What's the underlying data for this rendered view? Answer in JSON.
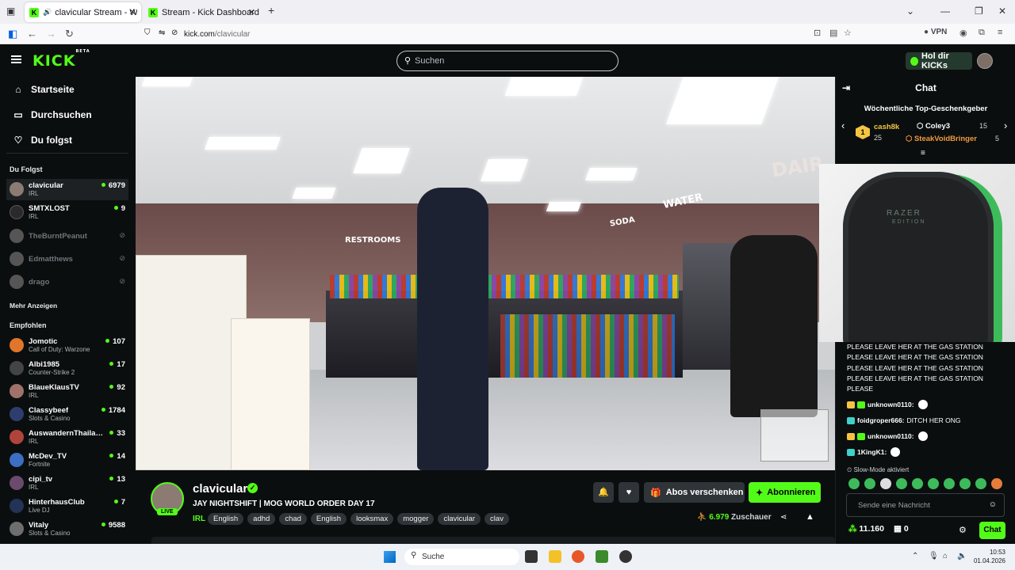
{
  "browser": {
    "tabs": [
      {
        "title": "clavicular Stream - Watch L",
        "active": true
      },
      {
        "title": "Stream - Kick Dashboard",
        "active": false
      }
    ],
    "new_tab": "+",
    "url_host": "kick.com",
    "url_path": "/clavicular",
    "vpn_label": "VPN"
  },
  "header": {
    "logo": "KICK",
    "logo_badge": "BETA",
    "search_placeholder": "Suchen",
    "get_kicks": "Hol dir KICKs"
  },
  "sidebar": {
    "nav": [
      {
        "label": "Startseite",
        "icon": "home-icon"
      },
      {
        "label": "Durchsuchen",
        "icon": "browse-icon"
      },
      {
        "label": "Du folgst",
        "icon": "heart-icon"
      }
    ],
    "following_title": "Du Folgst",
    "following": [
      {
        "name": "clavicular",
        "category": "IRL",
        "viewers": "6979",
        "live": true,
        "color": "#8b7b73"
      },
      {
        "name": "SMTXLOST",
        "category": "IRL",
        "viewers": "9",
        "live": true,
        "color": "#2a2a2a"
      },
      {
        "name": "TheBurntPeanut",
        "live": false,
        "color": "#555"
      },
      {
        "name": "Edmatthews",
        "live": false,
        "color": "#555"
      },
      {
        "name": "drago",
        "live": false,
        "color": "#555"
      }
    ],
    "show_more": "Mehr Anzeigen",
    "recommended_title": "Empfohlen",
    "recommended": [
      {
        "name": "Jomotic",
        "category": "Call of Duty: Warzone",
        "viewers": "107",
        "color": "#e0762a"
      },
      {
        "name": "Albi1985",
        "category": "Counter-Strike 2",
        "viewers": "17",
        "color": "#444"
      },
      {
        "name": "BlaueKlausTV",
        "category": "IRL",
        "viewers": "92",
        "color": "#a0726a"
      },
      {
        "name": "Classybeef",
        "category": "Slots & Casino",
        "viewers": "1784",
        "color": "#2d3e6e"
      },
      {
        "name": "AuswandernThaila…",
        "category": "IRL",
        "viewers": "33",
        "color": "#b0443a"
      },
      {
        "name": "McDev_TV",
        "category": "Fortnite",
        "viewers": "14",
        "color": "#3c6fc4"
      },
      {
        "name": "cipi_tv",
        "category": "IRL",
        "viewers": "13",
        "color": "#6b4a6e"
      },
      {
        "name": "HinterhausClub",
        "category": "Live DJ",
        "viewers": "7",
        "color": "#223355"
      },
      {
        "name": "Vitaly",
        "category": "Slots & Casino",
        "viewers": "9588",
        "color": "#6e6e6e"
      }
    ]
  },
  "video": {
    "signs": [
      "RESTROOMS",
      "WATER",
      "SODA",
      "DAIR"
    ]
  },
  "stream": {
    "streamer": "clavicular",
    "live_label": "LIVE",
    "title": "JAY NIGHTSHIFT | MOG WORLD ORDER DAY 17",
    "category": "IRL",
    "tags": [
      "English",
      "adhd",
      "chad",
      "English",
      "looksmax",
      "mogger",
      "clavicular",
      "clav"
    ],
    "gift_subs": "Abos verschenken",
    "subscribe": "Abonnieren",
    "viewers": "6.979",
    "viewers_label": "Zuschauer"
  },
  "chat": {
    "title": "Chat",
    "top_gifters_title": "Wöchentliche Top-Geschenkgeber",
    "gifters": [
      {
        "rank": "1",
        "name": "cash8k",
        "count": "25"
      },
      {
        "name": "Coley3",
        "count": "15"
      },
      {
        "name": "SteakVoidBringer",
        "count": "5"
      }
    ],
    "webcam_brand": "RAZER",
    "webcam_sub": "EDITION",
    "spam_lines": [
      "PLEASE LEAVE HER AT THE GAS STATION",
      "PLEASE LEAVE HER AT THE GAS STATION",
      "PLEASE LEAVE HER AT THE GAS STATION",
      "PLEASE LEAVE HER AT THE GAS STATION",
      "PLEASE"
    ],
    "messages": [
      {
        "user": "unknown0110:",
        "text": "",
        "user_color": "#fff"
      },
      {
        "user": "foidgroper666:",
        "text": "DITCH HER ONG",
        "user_color": "#fff"
      },
      {
        "user": "unknown0110:",
        "text": "",
        "user_color": "#fff"
      },
      {
        "user": "1KingK1:",
        "text": "",
        "user_color": "#fff"
      }
    ],
    "slow_mode": "Slow-Mode aktiviert",
    "input_placeholder": "Sende eine Nachricht",
    "kicks_balance": "11.160",
    "other_count": "0",
    "send_button": "Chat"
  },
  "taskbar": {
    "search": "Suche",
    "time": "10:53",
    "date": "01.04.2026"
  }
}
